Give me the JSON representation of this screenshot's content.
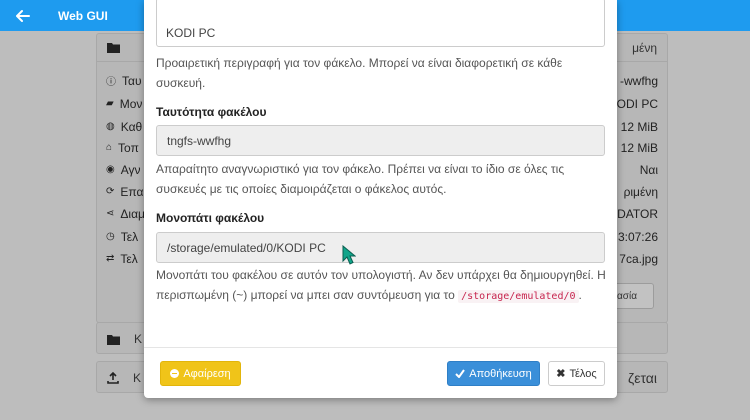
{
  "appbar": {
    "title": "Web GUI"
  },
  "background": {
    "card_top_right": "μένη",
    "rows": [
      {
        "label": "Ταυ",
        "value": "-wwfhg",
        "icon": "info-icon"
      },
      {
        "label": "Μον",
        "value": "KODI PC",
        "icon": "folder-icon"
      },
      {
        "label": "Καθ",
        "value": "12 MiB",
        "icon": "globe-icon"
      },
      {
        "label": "Τοπ",
        "value": "12 MiB",
        "icon": "home-icon"
      },
      {
        "label": "Αγν",
        "value": "Ναι",
        "icon": "eye-icon"
      },
      {
        "label": "Επα",
        "value": "ριμένη",
        "icon": "refresh-icon"
      },
      {
        "label": "Διαμ",
        "value": "EDATOR",
        "icon": "share-icon"
      },
      {
        "label": "Τελ",
        "value": "3:07:26",
        "icon": "clock-icon"
      },
      {
        "label": "Τελ",
        "value": "7ca.jpg",
        "icon": "swap-icon"
      }
    ],
    "card_button": "ασία",
    "card2_letter": "Κ",
    "card3_letter": "Κ",
    "card3_right": "ζεται"
  },
  "modal": {
    "top_input_value": "KODI PC",
    "label_help": "Προαιρετική περιγραφή για τον φάκελο. Μπορεί να είναι διαφορετική σε κάθε συσκευή.",
    "id_label": "Ταυτότητα φακέλου",
    "id_value": "tngfs-wwfhg",
    "id_help": "Απαραίτητο αναγνωριστικό για τον φάκελο. Πρέπει να είναι το ίδιο σε όλες τις συσκευές με τις οποίες διαμοιράζεται ο φάκελος αυτός.",
    "path_label": "Μονοπάτι φακέλου",
    "path_value": "/storage/emulated/0/KODI PC",
    "path_help_1": "Μονοπάτι του φακέλου σε αυτόν τον υπολογιστή. Αν δεν υπάρχει θα δημιουργηθεί. Η περισπωμένη (~) μπορεί να μπει σαν συντόμευση για το",
    "path_help_code": "/storage/emulated/0",
    "path_help_end": ".",
    "remove_label": "Αφαίρεση",
    "save_label": "Αποθήκευση",
    "close_label": "Τέλος"
  },
  "colors": {
    "appbar": "#1e9bef",
    "remove": "#f0c419",
    "save": "#3a8fd9",
    "cursor": "#0fa58a"
  }
}
